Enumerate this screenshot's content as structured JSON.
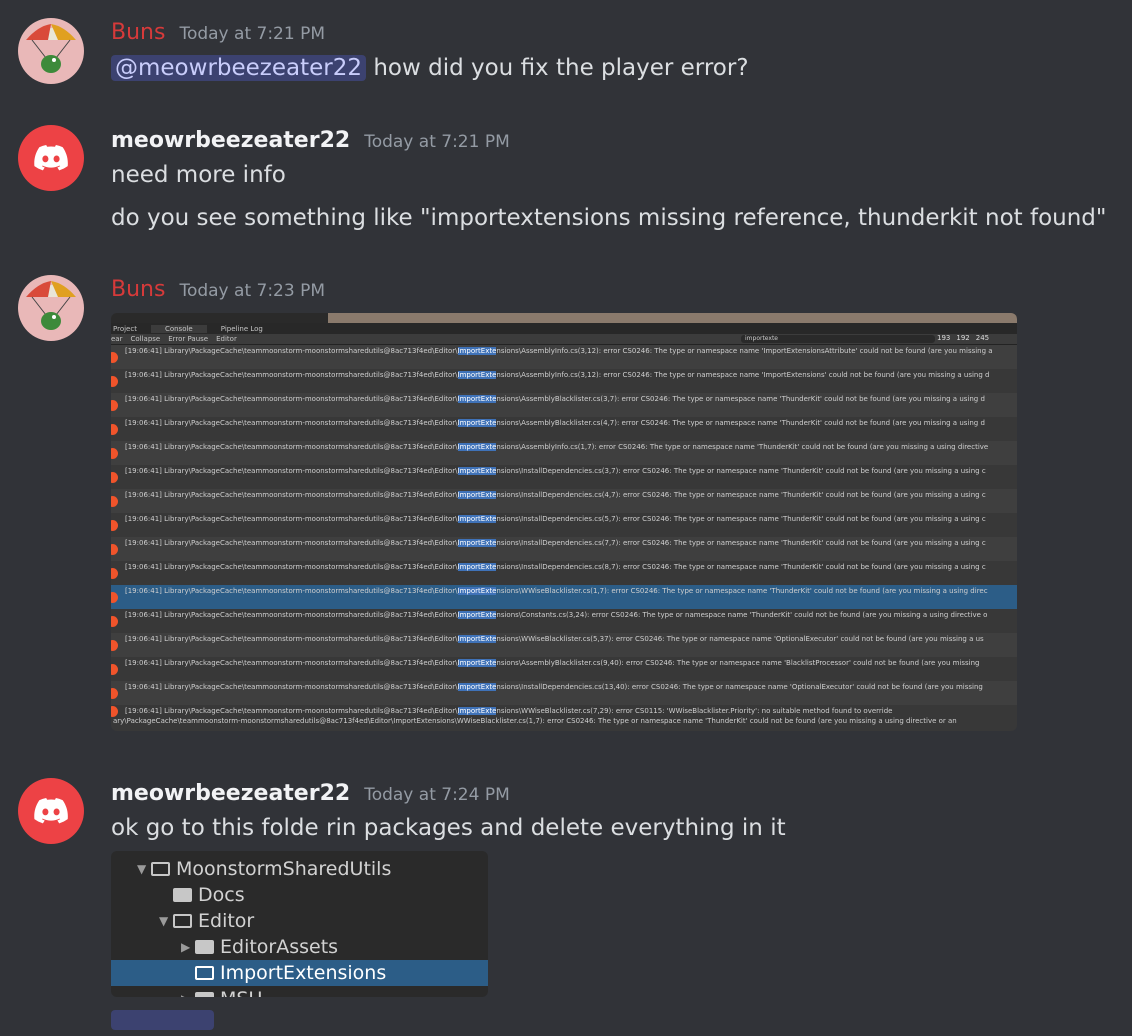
{
  "messages": [
    {
      "author": "Buns",
      "time": "Today at 7:21 PM",
      "mention": "@meowrbeezeater22",
      "text": "how did you fix the player error?"
    },
    {
      "author": "meowrbeezeater22",
      "time": "Today at 7:21 PM",
      "line1": "need more info",
      "line2": "do you see something like \"importextensions missing reference, thunderkit not found\""
    },
    {
      "author": "Buns",
      "time": "Today at 7:23 PM"
    },
    {
      "author": "meowrbeezeater22",
      "time": "Today at 7:24 PM",
      "text": "ok go to this folde rin packages and delete everything in it"
    }
  ],
  "console": {
    "tabs": [
      "Project",
      "Console",
      "Pipeline Log"
    ],
    "toolbar": [
      "ear",
      "Collapse",
      "Error Pause",
      "Editor"
    ],
    "search": "importexte",
    "counts": [
      "193",
      "192",
      "245"
    ],
    "path_prefix": "[19:06:41] Library\\PackageCache\\teammoonstorm-moonstormsharedutils@8ac713f4ed\\Editor\\",
    "highlight": "ImportExte",
    "rows": [
      "nsions\\AssemblyInfo.cs(3,12): error CS0246: The type or namespace name 'ImportExtensionsAttribute' could not be found (are you missing a",
      "nsions\\AssemblyInfo.cs(3,12): error CS0246: The type or namespace name 'ImportExtensions' could not be found (are you missing a using d",
      "nsions\\AssemblyBlacklister.cs(3,7): error CS0246: The type or namespace name 'ThunderKit' could not be found (are you missing a using d",
      "nsions\\AssemblyBlacklister.cs(4,7): error CS0246: The type or namespace name 'ThunderKit' could not be found (are you missing a using d",
      "nsions\\AssemblyInfo.cs(1,7): error CS0246: The type or namespace name 'ThunderKit' could not be found (are you missing a using directive",
      "nsions\\InstallDependencies.cs(3,7): error CS0246: The type or namespace name 'ThunderKit' could not be found (are you missing a using c",
      "nsions\\InstallDependencies.cs(4,7): error CS0246: The type or namespace name 'ThunderKit' could not be found (are you missing a using c",
      "nsions\\InstallDependencies.cs(5,7): error CS0246: The type or namespace name 'ThunderKit' could not be found (are you missing a using c",
      "nsions\\InstallDependencies.cs(7,7): error CS0246: The type or namespace name 'ThunderKit' could not be found (are you missing a using c",
      "nsions\\InstallDependencies.cs(8,7): error CS0246: The type or namespace name 'ThunderKit' could not be found (are you missing a using c",
      "nsions\\WWiseBlacklister.cs(1,7): error CS0246: The type or namespace name 'ThunderKit' could not be found (are you missing a using direc",
      "nsions\\Constants.cs(3,24): error CS0246: The type or namespace name 'ThunderKit' could not be found (are you missing a using directive o",
      "nsions\\WWiseBlacklister.cs(5,37): error CS0246: The type or namespace name 'OptionalExecutor' could not be found (are you missing a us",
      "nsions\\AssemblyBlacklister.cs(9,40): error CS0246: The type or namespace name 'BlacklistProcessor' could not be found (are you missing",
      "nsions\\InstallDependencies.cs(13,40): error CS0246: The type or namespace name 'OptionalExecutor' could not be found (are you missing",
      "nsions\\WWiseBlacklister.cs(7,29): error CS0115: 'WWiseBlacklister.Priority': no suitable method found to override"
    ],
    "selected_index": 10,
    "last_line": "ary\\PackageCache\\teammoonstorm-moonstormsharedutils@8ac713f4ed\\Editor\\ImportExtensions\\WWiseBlacklister.cs(1,7): error CS0246: The type or namespace name 'ThunderKit' could not be found (are you missing a using directive or an"
  },
  "tree": [
    {
      "label": "MoonstormSharedUtils",
      "depth": 0,
      "arrow": "▼",
      "icon": "open"
    },
    {
      "label": "Docs",
      "depth": 1,
      "arrow": "",
      "icon": "filled"
    },
    {
      "label": "Editor",
      "depth": 1,
      "arrow": "▼",
      "icon": "open"
    },
    {
      "label": "EditorAssets",
      "depth": 2,
      "arrow": "▶",
      "icon": "filled"
    },
    {
      "label": "ImportExtensions",
      "depth": 2,
      "arrow": "",
      "icon": "outline",
      "selected": true
    },
    {
      "label": "MSU",
      "depth": 2,
      "arrow": "▶",
      "icon": "filled"
    }
  ],
  "colors": {
    "background": "#313338",
    "buns": "#d63a3a",
    "discord": "#ed4245",
    "mention_bg": "#3c4270"
  }
}
